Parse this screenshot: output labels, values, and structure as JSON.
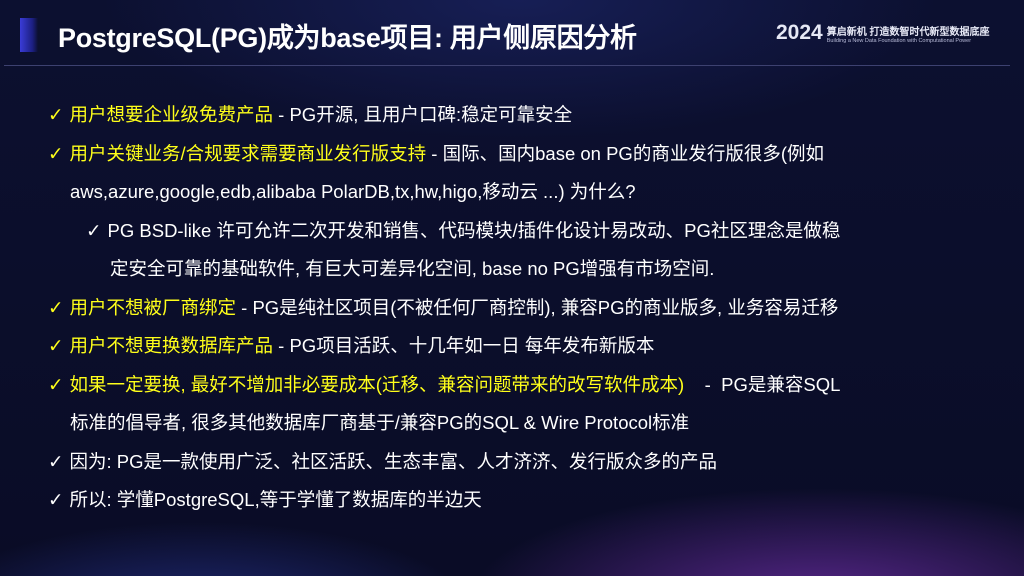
{
  "header": {
    "title": "PostgreSQL(PG)成为base项目: 用户侧原因分析",
    "brand_year": "2024",
    "brand_slogan": "算启新机 打造数智时代新型数据底座",
    "brand_subtitle": "Building a New Data Foundation with Computational Power"
  },
  "check": "✓",
  "items": [
    {
      "hl": "用户想要企业级免费产品",
      "text": " - PG开源, 且用户口碑:稳定可靠安全"
    },
    {
      "hl": "用户关键业务/合规要求需要商业发行版支持",
      "text": "  - 国际、国内base on PG的商业发行版很多(例如",
      "cont": "aws,azure,google,edb,alibaba PolarDB,tx,hw,higo,移动云 ...)  为什么?"
    },
    {
      "text": "PG BSD-like 许可允许二次开发和销售、代码模块/插件化设计易改动、PG社区理念是做稳",
      "cont": "定安全可靠的基础软件, 有巨大可差异化空间, base no PG增强有市场空间."
    },
    {
      "hl": "用户不想被厂商绑定",
      "text": " - PG是纯社区项目(不被任何厂商控制), 兼容PG的商业版多, 业务容易迁移"
    },
    {
      "hl": "用户不想更换数据库产品",
      "text": " - PG项目活跃、十几年如一日 每年发布新版本"
    },
    {
      "hl": "如果一定要换, 最好不增加非必要成本(迁移、兼容问题带来的改写软件成本)",
      "text": "    -  PG是兼容SQL",
      "cont": "标准的倡导者, 很多其他数据库厂商基于/兼容PG的SQL & Wire Protocol标准"
    },
    {
      "text": "因为: PG是一款使用广泛、社区活跃、生态丰富、人才济济、发行版众多的产品"
    },
    {
      "text": "所以: 学懂PostgreSQL,等于学懂了数据库的半边天"
    }
  ]
}
